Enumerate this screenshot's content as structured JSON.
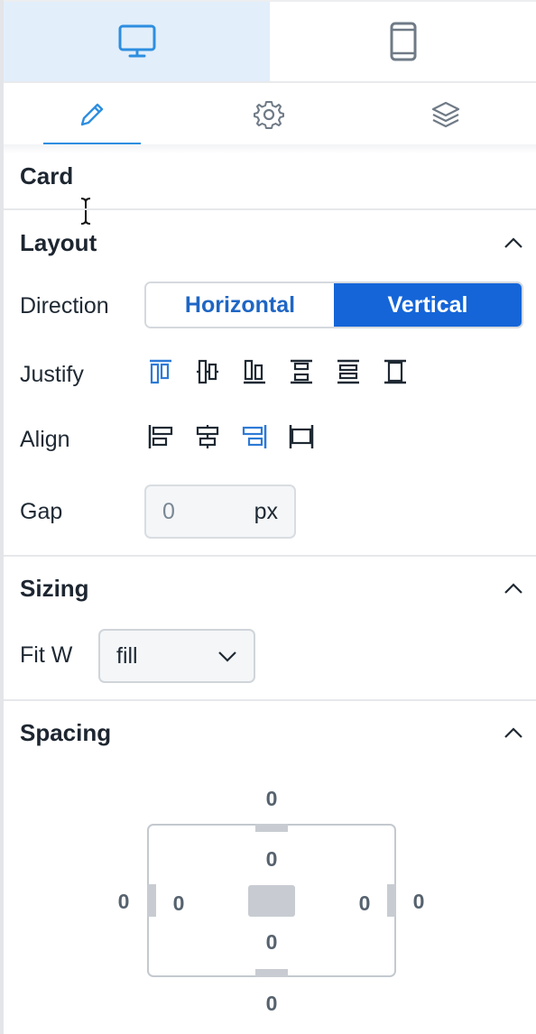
{
  "device_tabs": [
    {
      "label": "desktop",
      "icon": "monitor-icon",
      "active": true
    },
    {
      "label": "mobile",
      "icon": "phone-icon",
      "active": false
    }
  ],
  "tool_tabs": [
    {
      "icon": "pencil-icon",
      "active": true
    },
    {
      "icon": "gear-icon",
      "active": false
    },
    {
      "icon": "layers-icon",
      "active": false
    }
  ],
  "component_name": "Card",
  "layout": {
    "title": "Layout",
    "direction": {
      "label": "Direction",
      "options": [
        "Horizontal",
        "Vertical"
      ],
      "selected": "Vertical"
    },
    "justify": {
      "label": "Justify",
      "options": [
        "justify-start-icon",
        "justify-center-icon",
        "justify-end-icon",
        "justify-space-between-icon",
        "justify-space-around-icon",
        "justify-space-evenly-icon"
      ],
      "selected": "justify-start-icon"
    },
    "align": {
      "label": "Align",
      "options": [
        "align-start-icon",
        "align-center-icon",
        "align-end-icon",
        "align-stretch-icon"
      ],
      "selected": "align-end-icon"
    },
    "gap": {
      "label": "Gap",
      "value": "0",
      "unit": "px"
    }
  },
  "sizing": {
    "title": "Sizing",
    "fit_w": {
      "label": "Fit W",
      "value": "fill"
    }
  },
  "spacing": {
    "title": "Spacing",
    "margin": {
      "top": "0",
      "right": "0",
      "bottom": "0",
      "left": "0"
    },
    "padding": {
      "top": "0",
      "right": "0",
      "bottom": "0",
      "left": "0"
    }
  },
  "colors": {
    "accent": "#1565d8",
    "active_icon": "#2d8ee0",
    "active_tab_bg": "#e2eefa"
  }
}
